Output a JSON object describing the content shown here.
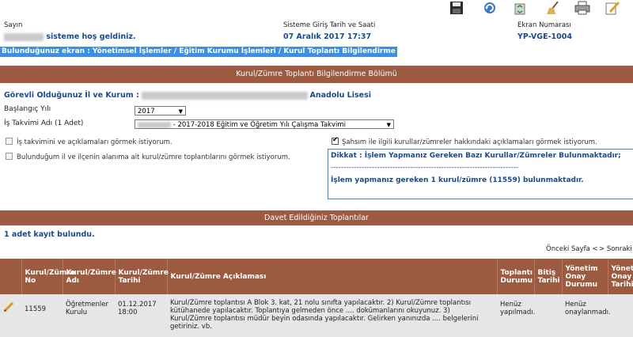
{
  "header": {
    "welcome_label": "Sayın",
    "welcome_text": "sisteme hoş geldiniz.",
    "login_label": "Sisteme Giriş Tarih ve Saati",
    "login_value": "07 Aralık 2017 17:37",
    "screen_no_label": "Ekran Numarası",
    "screen_no_value": "YP-VGE-1004"
  },
  "breadcrumb": "Bulunduğunuz ekran : Yönetimsel İşlemler / Eğitim Kurumu İşlemleri / Kurul Toplantı Bilgilendirme",
  "section_title": "Kurul/Zümre Toplantı Bilgilendirme Bölümü",
  "form": {
    "duty_label": "Görevli Olduğunuz İl ve Kurum :",
    "duty_value_tail": "Anadolu Lisesi",
    "start_year_label": "Başlangıç Yılı",
    "start_year_value": "2017",
    "work_calendar_label": "İş Takvimi Adı (1 Adet)",
    "work_calendar_value": "- 2017-2018 Eğitim ve Öğretim Yılı Çalışma Takvimi",
    "cb_calendar_label": "İş takvimini ve açıklamaları görmek istiyorum.",
    "cb_region_label": "Bulunduğum il ve ilçenin alanıma ait kurul/zümre toplantılarını görmek istiyorum.",
    "cb_personal_label": "Şahsım ile ilgili kurullar/zümreler hakkındaki açıklamaları görmek istiyorum."
  },
  "notice": {
    "line1": "Dikkat : İşlem Yapmanız Gereken Bazı Kurullar/Zümreler Bulunmaktadır;",
    "divider": "-------------------------------------------------------------------------",
    "line2": "İşlem yapmanız gereken 1 kurul/zümre (11559) bulunmaktadır."
  },
  "invites_title": "Davet Edildiğiniz Toplantılar",
  "record_count": "1 adet kayıt bulundu.",
  "pager": {
    "prev": "Önceki Sayfa <",
    "next": "> Sonraki Sayfa"
  },
  "table": {
    "headers": [
      "Kurul/Zümre No",
      "Kurul/Zümre Adı",
      "Kurul/Zümre Tarihi",
      "Kurul/Zümre Açıklaması",
      "Toplantı Durumu",
      "Bitiş Tarihi",
      "Yönetim Onay Durumu",
      "Yönetim Onay Tarihi"
    ],
    "rows": [
      {
        "no": "11559",
        "name": "Öğretmenler Kurulu",
        "date": "01.12.2017 18:00",
        "description": "Kurul/Zümre toplantısı A Blok 3. kat, 21 nolu sınıfta yapılacaktır. 2) Kurul/Zümre toplantısı kütühanede yapılacaktır. Toplantıya gelmeden önce .... dokümanlarını okuyunuz. 3) Kurul/Zümre toplantısı müdür beyin odasında yapılacaktır. Gelirken yanınızda .... belgelerini getiriniz. vb.",
        "status": "Henüz yapılmadı.",
        "end_date": "",
        "approval_status": "Henüz onaylanmadı.",
        "approval_date": ""
      }
    ]
  },
  "colors": {
    "section_bar": "#9c5a40",
    "breadcrumb_bg": "#3d8fe6",
    "link_blue": "#1a4a8a"
  },
  "icons": [
    "save-icon",
    "refresh-icon",
    "recycle-icon",
    "broom-icon",
    "print-icon",
    "edit-icon"
  ]
}
